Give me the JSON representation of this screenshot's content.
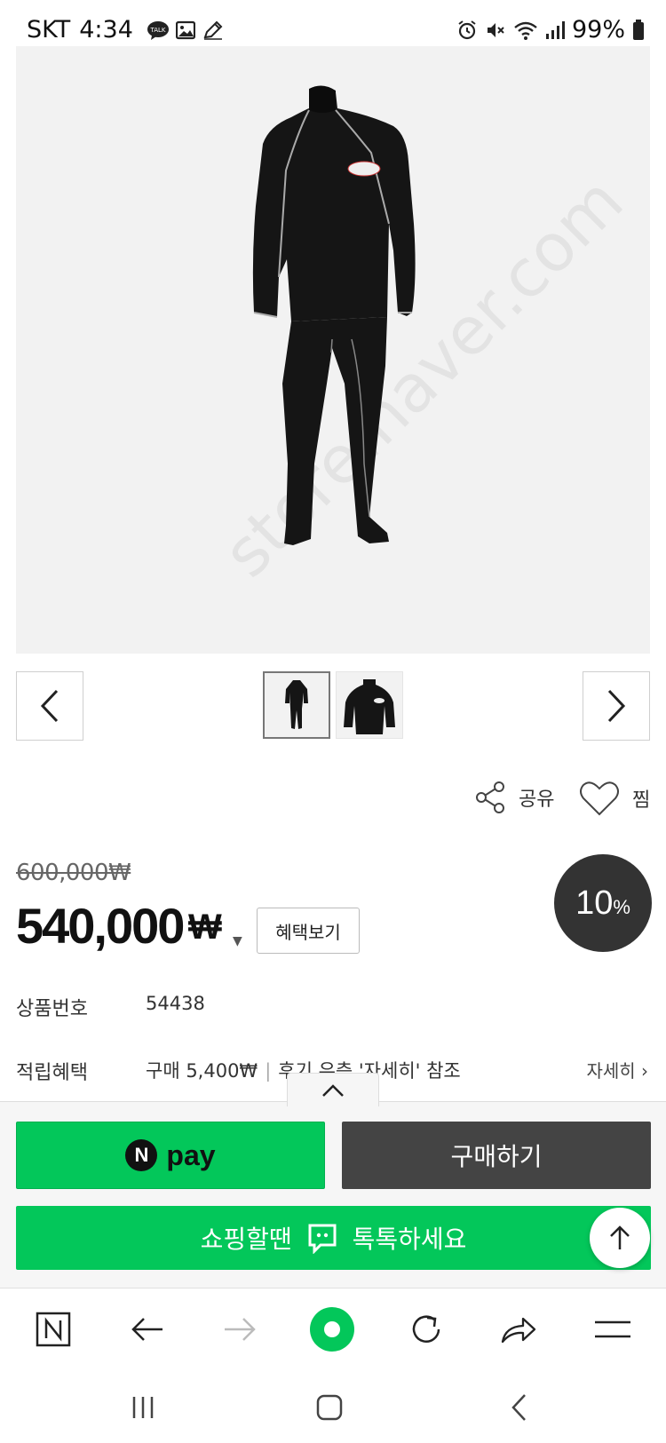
{
  "status_bar": {
    "carrier": "SKT",
    "time": "4:34",
    "battery": "99%",
    "left_icons": [
      "talk-icon",
      "gallery-icon",
      "pencil-icon"
    ],
    "right_icons": [
      "alarm-icon",
      "mute-icon",
      "wifi-icon",
      "signal-icon",
      "battery-icon"
    ]
  },
  "gallery": {
    "thumbnails": [
      "full-suit-thumbnail",
      "top-closeup-thumbnail"
    ],
    "selected_index": 0
  },
  "actions": {
    "share_label": "공유",
    "wish_label": "찜"
  },
  "price": {
    "original": "600,000₩",
    "sale": "540,000",
    "currency": "₩",
    "caret": "▼",
    "benefit_button": "혜택보기",
    "discount_number": "10",
    "discount_unit": "%"
  },
  "info": {
    "product_number_label": "상품번호",
    "product_number_value": "54438",
    "points_label": "적립혜택",
    "points_value": "구매 5,400₩",
    "points_separator": "|",
    "points_note": "후기 우측 '자세히' 참조",
    "detail_link": "자세히 ›"
  },
  "purchase_bar": {
    "npay_logo": "N",
    "npay_label": "pay",
    "buy_label": "구매하기",
    "talk_left": "쇼핑할땐",
    "talk_right": "톡톡하세요"
  },
  "browser_toolbar": [
    "naver-home-icon",
    "back-arrow-icon",
    "forward-arrow-icon",
    "green-dot-icon",
    "refresh-icon",
    "share-arrow-icon",
    "menu-icon"
  ],
  "system_nav": [
    "recents-icon",
    "home-icon",
    "back-icon"
  ],
  "colors": {
    "naver_green": "#03c75a",
    "buy_dark": "#444444",
    "badge_dark": "#333333"
  }
}
